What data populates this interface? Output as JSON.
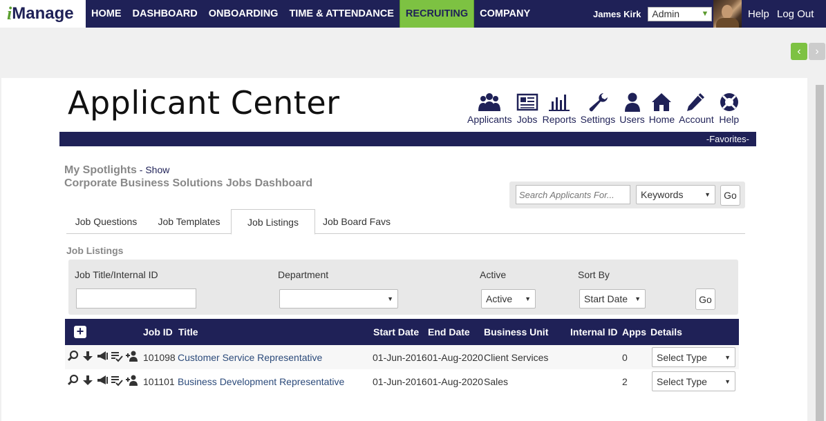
{
  "logo": {
    "i": "i",
    "rest": "Manage"
  },
  "nav": [
    {
      "label": "HOME",
      "active": false
    },
    {
      "label": "DASHBOARD",
      "active": false
    },
    {
      "label": "ONBOARDING",
      "active": false
    },
    {
      "label": "TIME & ATTENDANCE",
      "active": false
    },
    {
      "label": "RECRUITING",
      "active": true
    },
    {
      "label": "COMPANY",
      "active": false
    }
  ],
  "user": {
    "name": "James Kirk",
    "role": "Admin"
  },
  "top_links": {
    "help": "Help",
    "logout": "Log Out"
  },
  "page_title": "Applicant Center",
  "toolbar": [
    {
      "label": "Applicants",
      "icon": "users-icon"
    },
    {
      "label": "Jobs",
      "icon": "newspaper-icon"
    },
    {
      "label": "Reports",
      "icon": "bar-chart-icon"
    },
    {
      "label": "Settings",
      "icon": "wrench-icon"
    },
    {
      "label": "Users",
      "icon": "user-icon"
    },
    {
      "label": "Home",
      "icon": "home-icon"
    },
    {
      "label": "Account",
      "icon": "pencil-icon"
    },
    {
      "label": "Help",
      "icon": "lifebuoy-icon"
    }
  ],
  "favorites_label": "-Favorites-",
  "spotlights": {
    "label": "My Spotlights",
    "separator": " - ",
    "show": "Show"
  },
  "dashboard_title": "Corporate Business Solutions Jobs Dashboard",
  "search": {
    "placeholder": "Search Applicants For...",
    "type_value": "Keywords",
    "go": "Go"
  },
  "tabs": [
    {
      "label": "Job Questions",
      "active": false
    },
    {
      "label": "Job Templates",
      "active": false
    },
    {
      "label": "Job Listings",
      "active": true
    },
    {
      "label": "Job Board Favs",
      "active": false
    }
  ],
  "section_label": "Job Listings",
  "filters": {
    "title_label": "Job Title/Internal ID",
    "title_value": "",
    "department_label": "Department",
    "department_value": "",
    "active_label": "Active",
    "active_value": "Active",
    "sort_label": "Sort By",
    "sort_value": "Start Date",
    "go": "Go"
  },
  "table": {
    "add": "+",
    "headers": {
      "job_id": "Job ID",
      "title": "Title",
      "start_date": "Start Date",
      "end_date": "End Date",
      "business_unit": "Business Unit",
      "internal_id": "Internal ID",
      "apps": "Apps",
      "details": "Details"
    },
    "rows": [
      {
        "job_id": "101098",
        "title": "Customer Service Representative",
        "start_date": "01-Jun-2016",
        "end_date": "01-Aug-2020",
        "business_unit": "Client Services",
        "internal_id": "",
        "apps": "0",
        "details": "Select Type"
      },
      {
        "job_id": "101101",
        "title": "Business Development Representative",
        "start_date": "01-Jun-2016",
        "end_date": "01-Aug-2020",
        "business_unit": "Sales",
        "internal_id": "",
        "apps": "2",
        "details": "Select Type"
      }
    ]
  },
  "colors": {
    "navy": "#1f2157",
    "green": "#7dc242"
  }
}
